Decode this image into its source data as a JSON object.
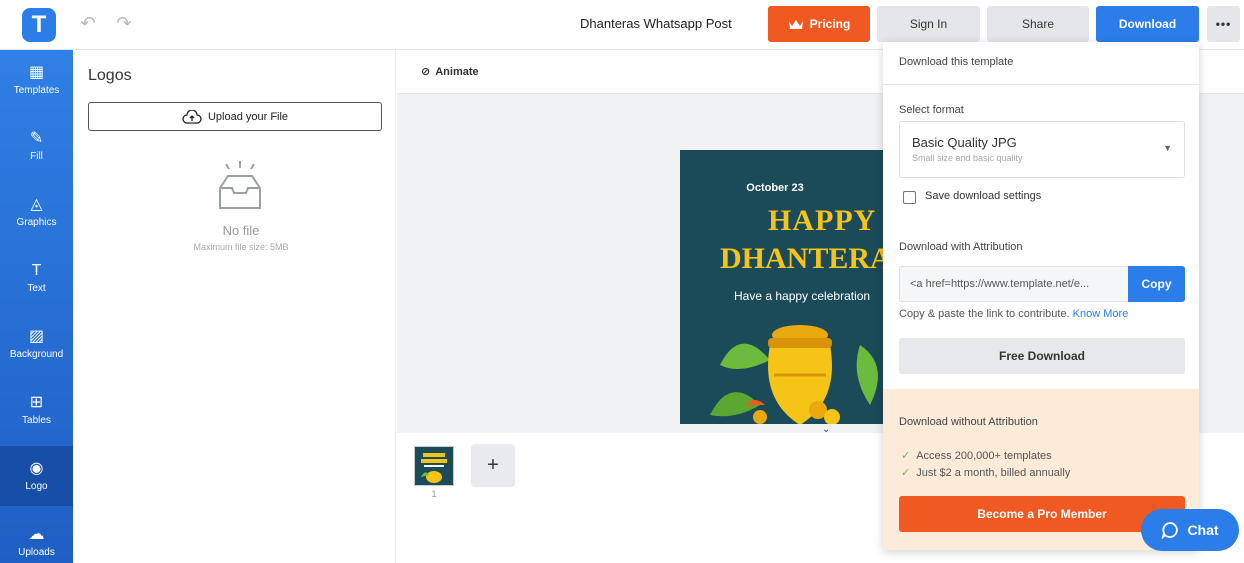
{
  "topbar": {
    "logo_letter": "T",
    "doc_title": "Dhanteras Whatsapp Post",
    "pricing_label": "Pricing",
    "signin_label": "Sign In",
    "share_label": "Share",
    "download_label": "Download",
    "more_label": "•••"
  },
  "rail": [
    {
      "label": "Templates",
      "icon": "▦"
    },
    {
      "label": "Fill",
      "icon": "✎"
    },
    {
      "label": "Graphics",
      "icon": "◬"
    },
    {
      "label": "Text",
      "icon": "T"
    },
    {
      "label": "Background",
      "icon": "▨"
    },
    {
      "label": "Tables",
      "icon": "⊞"
    },
    {
      "label": "Logo",
      "icon": "◉"
    },
    {
      "label": "Uploads",
      "icon": "☁"
    }
  ],
  "panel": {
    "title": "Logos",
    "upload_label": "Upload your File",
    "empty_title": "No file",
    "empty_sub": "Maximum file size: 5MB"
  },
  "canvas": {
    "animate_label": "Animate",
    "poster_date": "October 23",
    "poster_line1": "HAPPY",
    "poster_line2": "DHANTERAS",
    "poster_sub": "Have a happy celebration"
  },
  "pages": {
    "page_number": "1",
    "add_label": "+"
  },
  "download_menu": {
    "header": "Download this template",
    "select_format_label": "Select format",
    "format_main": "Basic Quality JPG",
    "format_sub": "Small size and basic quality",
    "save_settings_label": "Save download settings",
    "attribution_label": "Download with Attribution",
    "attribution_value": "<a href=https://www.template.net/e...",
    "copy_label": "Copy",
    "contribute_text": "Copy & paste the link to contribute.",
    "know_more": "Know More",
    "free_download_label": "Free Download",
    "without_attr_label": "Download without Attribution",
    "feature_1": "Access 200,000+ templates",
    "feature_2": "Just $2 a month, billed annually",
    "pro_button": "Become a Pro Member"
  },
  "chat": {
    "label": "Chat"
  },
  "colors": {
    "brand_blue": "#2b7de9",
    "orange": "#f05a22",
    "pro_bg": "#fcebd9",
    "poster_bg": "#1b4a58",
    "poster_gold": "#f6c317"
  }
}
